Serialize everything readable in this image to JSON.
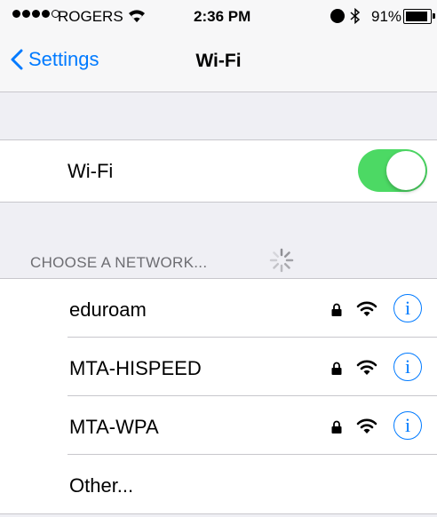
{
  "status_bar": {
    "carrier": "ROGERS",
    "time": "2:36 PM",
    "battery_percent": "91%",
    "battery_level": 0.91,
    "signal_bars": 4,
    "signal_max": 5
  },
  "nav": {
    "back_label": "Settings",
    "title": "Wi-Fi"
  },
  "wifi": {
    "label": "Wi-Fi",
    "enabled": true,
    "toggle_color": "#4cd964"
  },
  "section_header": "CHOOSE A NETWORK...",
  "networks": [
    {
      "name": "eduroam",
      "secured": true,
      "icons": [
        "lock-icon",
        "wifi-signal-icon",
        "info-icon"
      ]
    },
    {
      "name": "MTA-HISPEED",
      "secured": true,
      "icons": [
        "lock-icon",
        "wifi-signal-icon",
        "info-icon"
      ]
    },
    {
      "name": "MTA-WPA",
      "secured": true,
      "icons": [
        "lock-icon",
        "wifi-signal-icon",
        "info-icon"
      ]
    }
  ],
  "other_label": "Other...",
  "info_glyph": "i",
  "colors": {
    "accent": "#007aff",
    "toggle_on": "#4cd964",
    "background": "#efeff4"
  }
}
